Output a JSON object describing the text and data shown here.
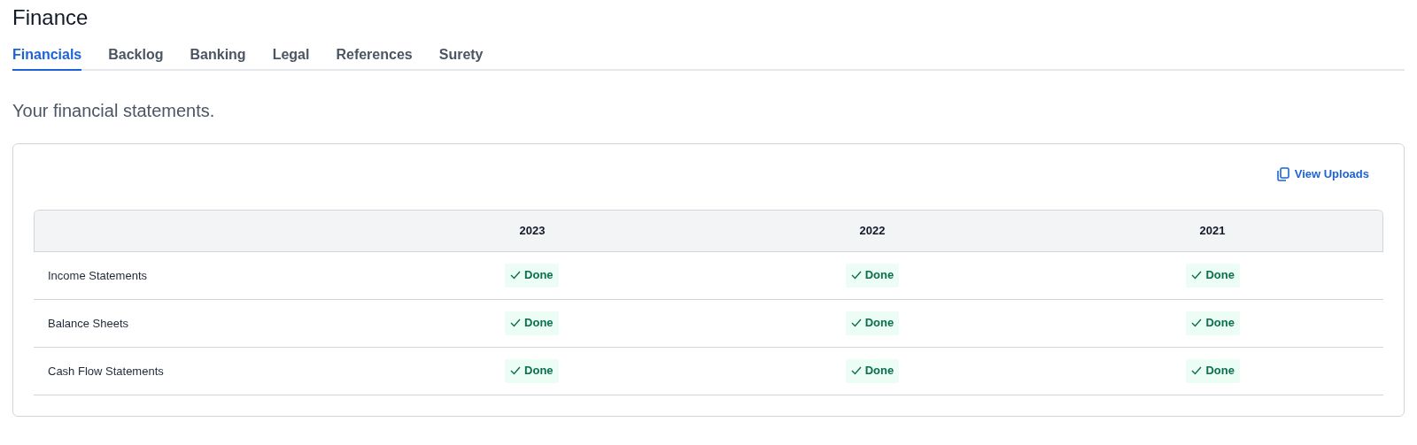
{
  "page_title": "Finance",
  "tabs": [
    {
      "label": "Financials",
      "selected": true
    },
    {
      "label": "Backlog",
      "selected": false
    },
    {
      "label": "Banking",
      "selected": false
    },
    {
      "label": "Legal",
      "selected": false
    },
    {
      "label": "References",
      "selected": false
    },
    {
      "label": "Surety",
      "selected": false
    }
  ],
  "subtitle": "Your financial statements.",
  "view_uploads_link": "View Uploads",
  "table": {
    "columns": [
      "2023",
      "2022",
      "2021"
    ],
    "rows": [
      {
        "label": "Income Statements",
        "cells": [
          "Done",
          "Done",
          "Done"
        ]
      },
      {
        "label": "Balance Sheets",
        "cells": [
          "Done",
          "Done",
          "Done"
        ]
      },
      {
        "label": "Cash Flow Statements",
        "cells": [
          "Done",
          "Done",
          "Done"
        ]
      }
    ]
  }
}
